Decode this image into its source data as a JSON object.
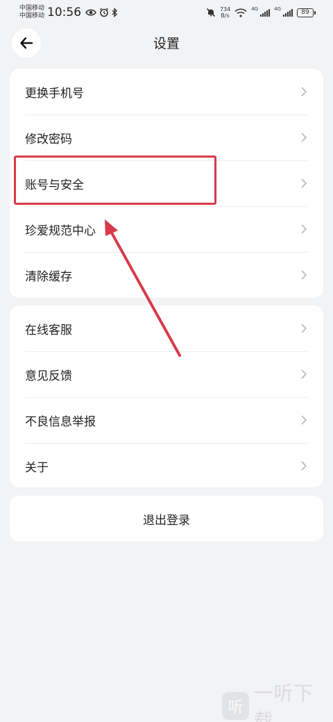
{
  "status_bar": {
    "carrier_1": "中国移动",
    "carrier_2": "中国移动",
    "time": "10:56",
    "speed_value": "734",
    "speed_unit": "B/s",
    "net_1": "4G",
    "net_2": "4G",
    "battery": "89"
  },
  "header": {
    "title": "设置"
  },
  "group_1": [
    {
      "label": "更换手机号"
    },
    {
      "label": "修改密码"
    },
    {
      "label": "账号与安全"
    },
    {
      "label": "珍爱规范中心"
    },
    {
      "label": "清除缓存"
    }
  ],
  "group_2": [
    {
      "label": "在线客服"
    },
    {
      "label": "意见反馈"
    },
    {
      "label": "不良信息举报"
    },
    {
      "label": "关于"
    }
  ],
  "logout": {
    "label": "退出登录"
  },
  "annotation": {
    "color": "#d83a4a"
  },
  "watermark": {
    "logo_text": "听",
    "text": "一听下载"
  },
  "icons": {
    "back": "arrow-left-icon",
    "chevron": "chevron-right-icon"
  }
}
